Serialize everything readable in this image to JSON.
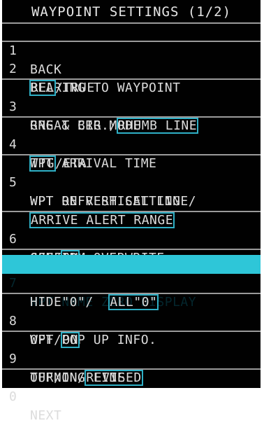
{
  "menu": {
    "title": "WAYPOINT SETTINGS (1/2)",
    "accent_color": "#2fb0c6",
    "highlight_color": "#2ec6d8",
    "items": [
      {
        "num": "1",
        "label": "BACK"
      },
      {
        "num": "2",
        "label": "BEARING TO WAYPOINT",
        "options": [
          "REL",
          "/TRUE"
        ]
      },
      {
        "num": "3",
        "label": "RNG & BRG MODE",
        "options": [
          "GREAT CIR./",
          "RHUMB LINE"
        ]
      },
      {
        "num": "4",
        "label": "WPT ARRIVAL TIME",
        "options": [
          "TTG",
          "/ETA"
        ]
      },
      {
        "num": "5",
        "label": "WPT REFRESH SETTING",
        "options": [
          "WPT ON VERTICAL LINE/",
          "ARRIVE ALERT RANGE"
        ]
      },
      {
        "num": "6",
        "label": "CONFIRM OVERWRITE",
        "options": [
          "OFF/",
          "ON"
        ]
      },
      {
        "num": "7",
        "label": "WPT NAME ZERO DISPLAY",
        "options": [
          "HIDE\"0\"/  ",
          "ALL\"0\""
        ]
      },
      {
        "num": "8",
        "label": "WPT POP UP INFO.",
        "options": [
          "OFF/",
          "ON"
        ]
      },
      {
        "num": "9",
        "label": "TURNING LINE",
        "options": [
          "OFF/ON/",
          "REVISED"
        ]
      },
      {
        "num": "0",
        "label": "NEXT"
      }
    ]
  }
}
